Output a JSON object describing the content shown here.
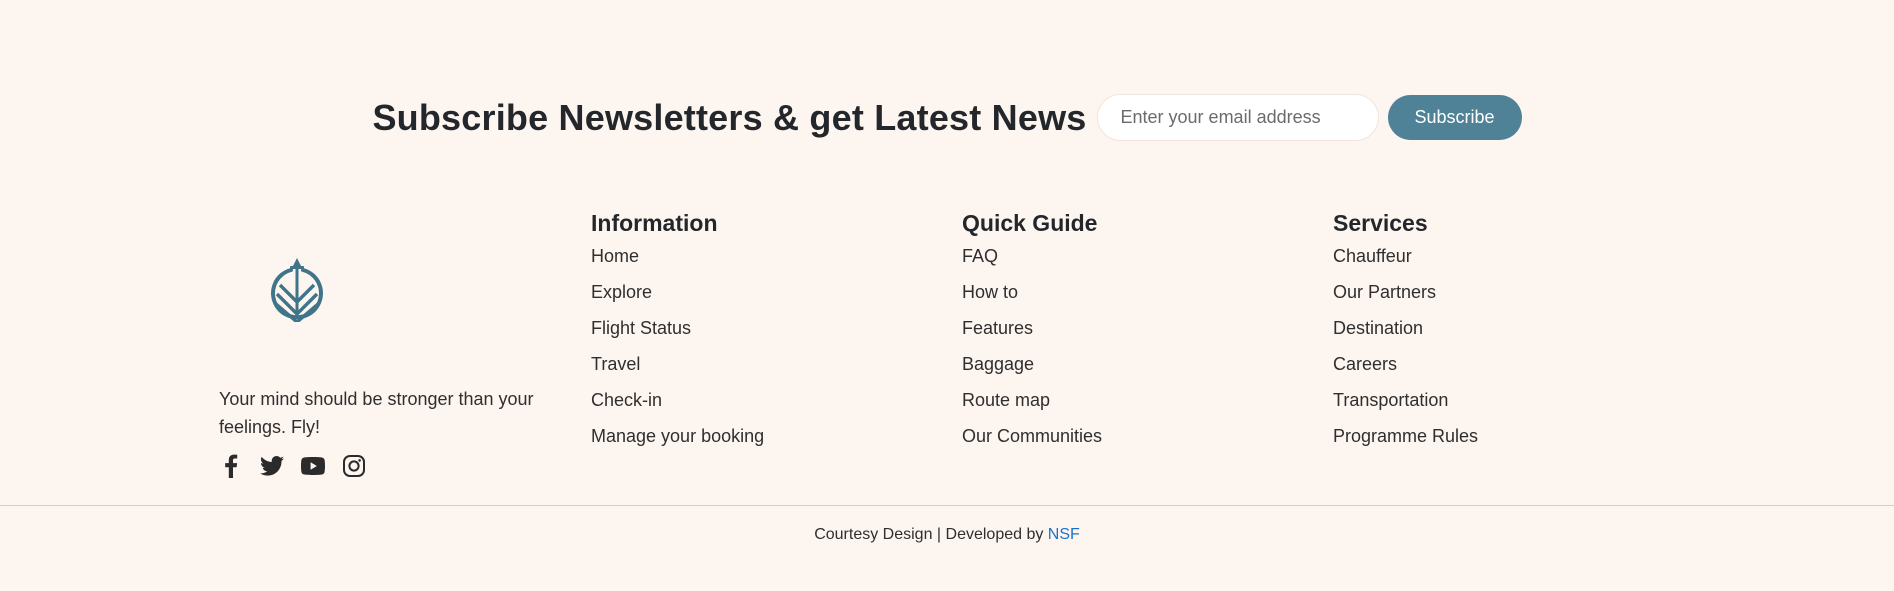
{
  "newsletter": {
    "title": "Subscribe Newsletters & get Latest News",
    "email_placeholder": "Enter your email address",
    "subscribe_label": "Subscribe"
  },
  "brand": {
    "logo_icon": "plane-peace-logo-icon",
    "tagline": "Your mind should be stronger than your feelings. Fly!",
    "socials": [
      "facebook-icon",
      "twitter-icon",
      "youtube-icon",
      "instagram-icon"
    ]
  },
  "columns": [
    {
      "heading": "Information",
      "links": [
        "Home",
        "Explore",
        "Flight Status",
        "Travel",
        "Check-in",
        "Manage your booking"
      ]
    },
    {
      "heading": "Quick Guide",
      "links": [
        "FAQ",
        "How to",
        "Features",
        "Baggage",
        "Route map",
        "Our Communities"
      ]
    },
    {
      "heading": "Services",
      "links": [
        "Chauffeur",
        "Our Partners",
        "Destination",
        "Careers",
        "Transportation",
        "Programme Rules"
      ]
    }
  ],
  "footer": {
    "credit_prefix": "Courtesy Design | Developed by ",
    "credit_link": "NSF"
  },
  "colors": {
    "background": "#fdf5f0",
    "accent": "#4f8296",
    "link": "#1a73c9"
  }
}
